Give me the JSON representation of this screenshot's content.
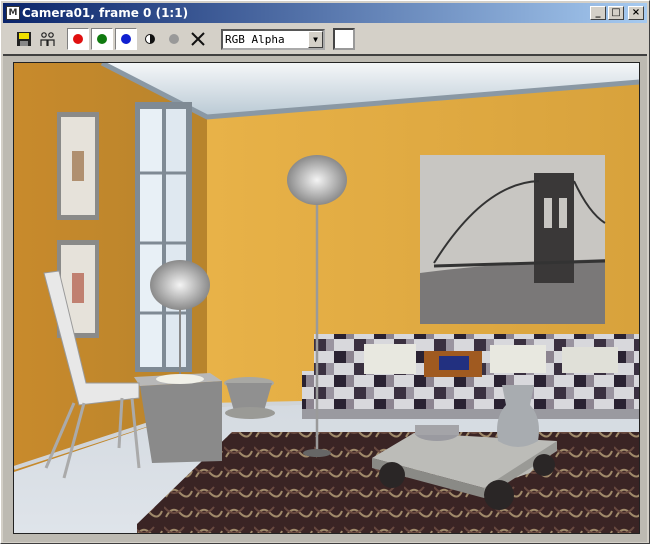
{
  "window": {
    "title": "Camera01, frame 0 (1:1)",
    "app_icon": "max-icon",
    "controls": {
      "minimize": "_",
      "maximize": "□",
      "close": "×"
    }
  },
  "toolbar": {
    "save_icon": "floppy-disk-icon",
    "clone_icon": "clone-window-icon",
    "channels": [
      {
        "name": "red",
        "color": "#e01010",
        "enabled": true
      },
      {
        "name": "green",
        "color": "#107a10",
        "enabled": true
      },
      {
        "name": "blue",
        "color": "#1020d0",
        "enabled": true
      }
    ],
    "mono_icon": "monochrome-icon",
    "clear_icon": "clear-x-icon",
    "channel_select": "RGB Alpha",
    "swatch_color": "#ffffff"
  },
  "render": {
    "description_icon": "rendered-room-image"
  }
}
